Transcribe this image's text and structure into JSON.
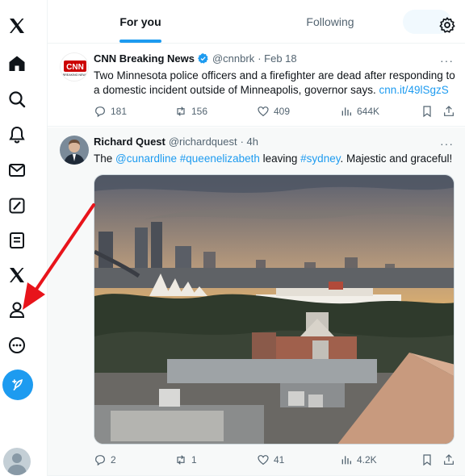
{
  "tabs": {
    "for_you": "For you",
    "following": "Following"
  },
  "tweets": [
    {
      "name": "CNN Breaking News",
      "handle": "@cnnbrk",
      "time": "· Feb 18",
      "text": "Two Minnesota police officers and a firefighter are dead after responding to a domestic incident outside of Minneapolis, governor says.",
      "link": "cnn.it/49lSgzS",
      "avatar_text": "CNN",
      "avatar_sub": "BREAKING NEWS",
      "replies": "181",
      "reposts": "156",
      "likes": "409",
      "views": "644K"
    },
    {
      "name": "Richard Quest",
      "handle": "@richardquest",
      "time": "· 4h",
      "text_parts": {
        "prefix": "The ",
        "mention": "@cunardline",
        "tag1": "#queenelizabeth",
        "mid": " leaving ",
        "tag2": "#sydney",
        "suffix": ". Majestic and graceful!"
      },
      "replies": "2",
      "reposts": "1",
      "likes": "41",
      "views": "4.2K"
    }
  ],
  "more": "···",
  "colors": {
    "accent": "#1d9bf0",
    "arrow": "#e8141b",
    "cnn_red": "#cc0000"
  }
}
